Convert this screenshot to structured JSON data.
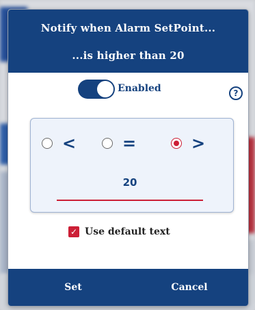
{
  "dialog": {
    "title_line1": "Notify when Alarm SetPoint...",
    "title_line2": "...is higher than 20"
  },
  "toggle": {
    "label": "Enabled",
    "state": "on"
  },
  "help": {
    "icon": "question-circle-icon",
    "glyph": "?"
  },
  "comparators": [
    {
      "symbol": "<",
      "selected": false
    },
    {
      "symbol": "=",
      "selected": false
    },
    {
      "symbol": ">",
      "selected": true
    }
  ],
  "threshold": {
    "value": "20"
  },
  "default_text": {
    "label": "Use default text",
    "checked": true
  },
  "buttons": {
    "set": "Set",
    "cancel": "Cancel"
  },
  "colors": {
    "primary": "#15427f",
    "accent": "#cc1f36"
  }
}
